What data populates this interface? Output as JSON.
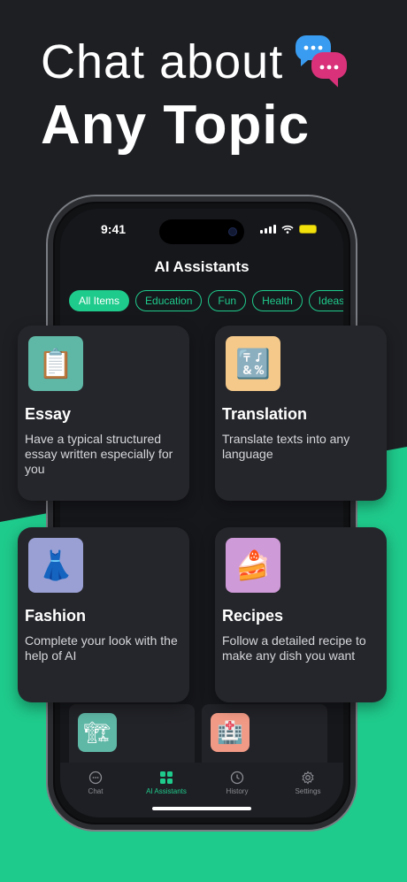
{
  "colors": {
    "background": "#1e1f23",
    "accent": "#1fcb8c",
    "card": "#25262b"
  },
  "headline": {
    "line1": "Chat about",
    "line2": "Any Topic"
  },
  "status_bar": {
    "time": "9:41"
  },
  "screen_title": "AI Assistants",
  "chips": [
    {
      "label": "All Items",
      "active": true
    },
    {
      "label": "Education",
      "active": false
    },
    {
      "label": "Fun",
      "active": false
    },
    {
      "label": "Health",
      "active": false
    },
    {
      "label": "Ideas",
      "active": false
    }
  ],
  "cards": [
    {
      "title": "Essay",
      "description": "Have a typical structured essay written especially for you",
      "icon": "clipboard-icon",
      "icon_bg": "#5fb7a6"
    },
    {
      "title": "Translation",
      "description": "Translate texts into any language",
      "icon": "input-symbols-icon",
      "icon_bg": "#f5c98a"
    },
    {
      "title": "Fashion",
      "description": "Complete your look with the help of AI",
      "icon": "dress-icon",
      "icon_bg": "#9aa0d4"
    },
    {
      "title": "Recipes",
      "description": "Follow a detailed recipe to make any dish you want",
      "icon": "cake-icon",
      "icon_bg": "#cf9ad8"
    }
  ],
  "mini_cards": [
    {
      "icon": "crane-icon",
      "icon_bg": "#5fb7a6"
    },
    {
      "icon": "hospital-icon",
      "icon_bg": "#f19a86"
    }
  ],
  "tabs": [
    {
      "label": "Chat",
      "icon": "chat-bubble-icon",
      "active": false
    },
    {
      "label": "AI Assistants",
      "icon": "grid-icon",
      "active": true
    },
    {
      "label": "History",
      "icon": "clock-icon",
      "active": false
    },
    {
      "label": "Settings",
      "icon": "gear-icon",
      "active": false
    }
  ]
}
